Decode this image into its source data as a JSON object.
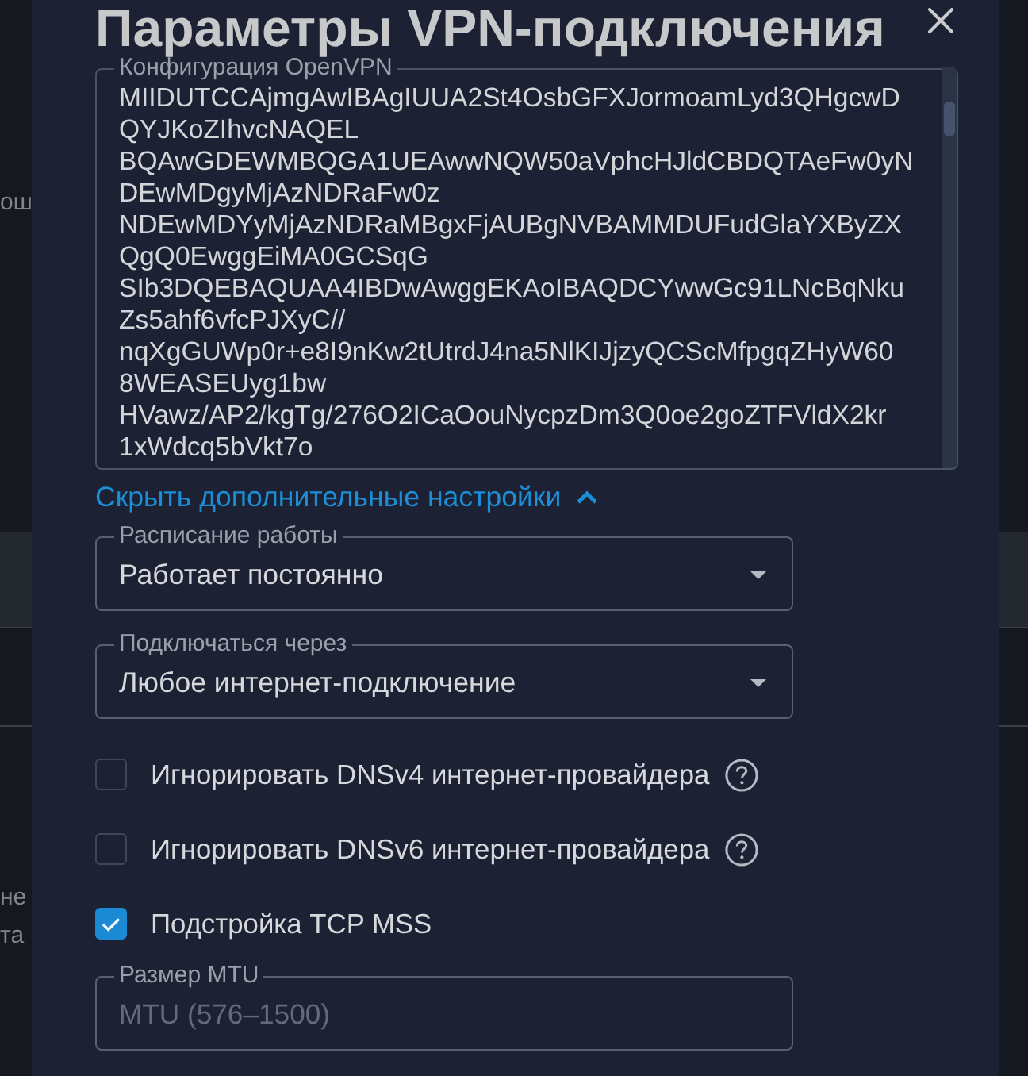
{
  "window": {
    "title": "Параметры VPN-подключения"
  },
  "background_page": {
    "fragments": [
      {
        "text": "ош"
      },
      {
        "text": "не"
      },
      {
        "text": "та"
      }
    ]
  },
  "config": {
    "label": "Конфигурация OpenVPN",
    "lines": [
      "MIIDUTCCAjmgAwIBAgIUUA2St4OsbGFXJormoamLyd3QHgcwD",
      "QYJKoZIhvcNAQEL",
      "BQAwGDEWMBQGA1UEAwwNQW50aVphcHJldCBDQTAeFw0yN",
      "DEwMDgyMjAzNDRaFw0z",
      "NDEwMDYyMjAzNDRaMBgxFjAUBgNVBAMMDUFudGlaYXByZX",
      "QgQ0EwggEiMA0GCSqG",
      "SIb3DQEBAQUAA4IBDwAwggEKAoIBAQDCYwwGc91LNcBqNku",
      "Zs5ahf6vfcPJXyC//",
      "nqXgGUWp0r+e8I9nKw2tUtrdJ4na5NlKIJjzyQCScMfpgqZHyW60",
      "8WEASEUyg1bw",
      "HVawz/AP2/kgTg/276O2ICaOouNycpzDm3Q0oe2goZTFVldX2kr",
      "1xWdcq5bVkt7o"
    ]
  },
  "toggle_link": {
    "label": "Скрыть дополнительные настройки",
    "expanded": true
  },
  "selects": [
    {
      "label": "Расписание работы",
      "value": "Работает постоянно"
    },
    {
      "label": "Подключаться через",
      "value": "Любое интернет-подключение"
    }
  ],
  "checkboxes": [
    {
      "label": "Игнорировать DNSv4 интернет-провайдера",
      "checked": false,
      "help": true
    },
    {
      "label": "Игнорировать DNSv6 интернет-провайдера",
      "checked": false,
      "help": true
    },
    {
      "label": "Подстройка TCP MSS",
      "checked": true,
      "help": false
    }
  ],
  "mtu": {
    "label": "Размер MTU",
    "placeholder": "MTU (576–1500)"
  }
}
